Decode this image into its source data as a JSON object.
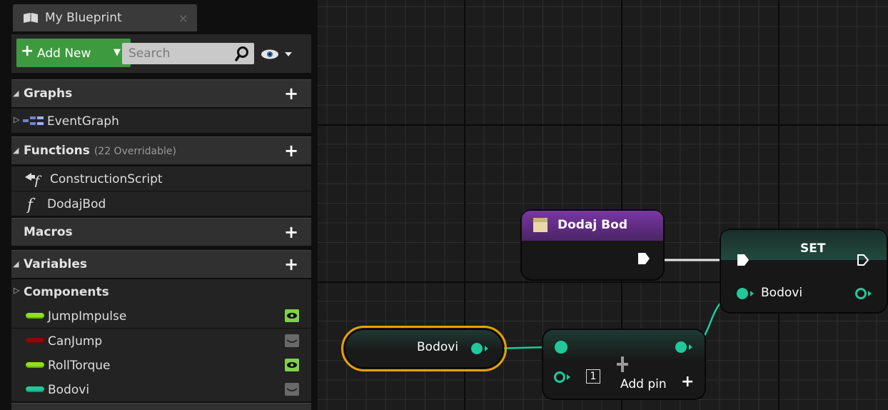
{
  "tab": {
    "title": "My Blueprint",
    "close": "×"
  },
  "toolbar": {
    "add_new": "Add New",
    "search_placeholder": "Search"
  },
  "sections": {
    "graphs": {
      "title": "Graphs",
      "items": [
        "EventGraph"
      ]
    },
    "functions": {
      "title": "Functions",
      "count": "(22 Overridable)",
      "items": [
        "ConstructionScript",
        "DodajBod"
      ]
    },
    "macros": {
      "title": "Macros"
    },
    "variables": {
      "title": "Variables",
      "components": "Components",
      "items": [
        {
          "name": "JumpImpulse",
          "color": "#8fe01f",
          "visible": true
        },
        {
          "name": "CanJump",
          "color": "#8a0b0b",
          "visible": false
        },
        {
          "name": "RollTorque",
          "color": "#8fe01f",
          "visible": true
        },
        {
          "name": "Bodovi",
          "color": "#21c89a",
          "visible": false
        }
      ]
    }
  },
  "graph": {
    "event_node": {
      "title": "Dodaj Bod"
    },
    "set_node": {
      "title": "SET",
      "pin": "Bodovi"
    },
    "get_node": {
      "label": "Bodovi"
    },
    "add_node": {
      "index": "1",
      "add_pin": "Add pin"
    }
  },
  "colors": {
    "pin_teal": "#21c89a",
    "accent_green": "#3e9a3e",
    "selection_orange": "#e8a000",
    "function_purple": "#7a36a3"
  }
}
